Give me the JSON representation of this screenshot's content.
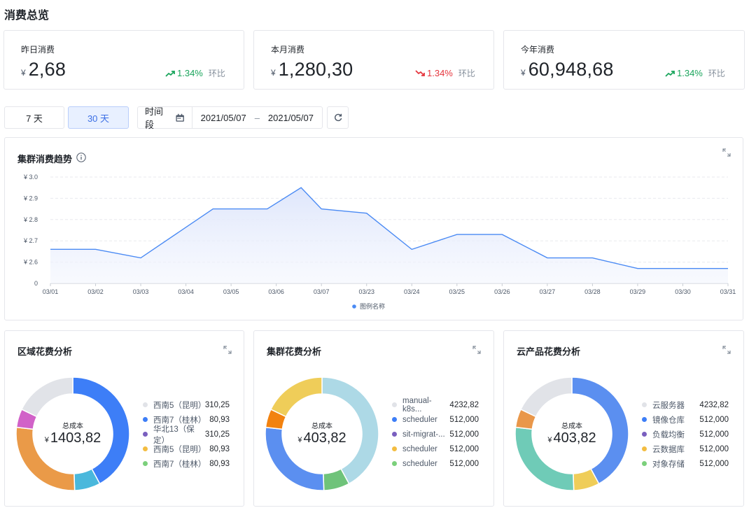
{
  "page": {
    "title": "消费总览"
  },
  "stats": [
    {
      "label": "昨日消费",
      "currency": "¥",
      "value": "2,68",
      "pct": "1.34%",
      "ref": "环比",
      "direction": "up",
      "color": "#1aa55c"
    },
    {
      "label": "本月消费",
      "currency": "¥",
      "value": "1,280,30",
      "pct": "1.34%",
      "ref": "环比",
      "direction": "down",
      "color": "#e5353d"
    },
    {
      "label": "今年消费",
      "currency": "¥",
      "value": "60,948,68",
      "pct": "1.34%",
      "ref": "环比",
      "direction": "up",
      "color": "#1aa55c"
    }
  ],
  "filters": {
    "btn7": "7 天",
    "btn30": "30 天",
    "range_label": "时间段",
    "start": "2021/05/07",
    "sep": "–",
    "end": "2021/05/07"
  },
  "trend": {
    "title": "集群消费趋势"
  },
  "donuts": [
    {
      "title": "区域花费分析",
      "center_label": "总成本",
      "currency": "¥",
      "center_value": "1403,82",
      "legend": [
        {
          "name": "西南5（昆明）",
          "value": "310,25",
          "color": "#e1e3e8"
        },
        {
          "name": "西南7（桂林）",
          "value": "80,93",
          "color": "#3d7ef7"
        },
        {
          "name": "华北13（保定）",
          "value": "310,25",
          "color": "#7a5fbf"
        },
        {
          "name": "西南5（昆明）",
          "value": "80,93",
          "color": "#f3bd41"
        },
        {
          "name": "西南7（桂林）",
          "value": "80,93",
          "color": "#7bd07b"
        }
      ]
    },
    {
      "title": "集群花费分析",
      "center_label": "总成本",
      "currency": "¥",
      "center_value": "403,82",
      "legend": [
        {
          "name": "manual-k8s...",
          "value": "4232,82",
          "color": "#e1e3e8"
        },
        {
          "name": "scheduler",
          "value": "512,000",
          "color": "#3d7ef7"
        },
        {
          "name": "sit-migrat-...",
          "value": "512,000",
          "color": "#7a5fbf"
        },
        {
          "name": "scheduler",
          "value": "512,000",
          "color": "#f3bd41"
        },
        {
          "name": "scheduler",
          "value": "512,000",
          "color": "#7bd07b"
        }
      ]
    },
    {
      "title": "云产品花费分析",
      "center_label": "总成本",
      "currency": "¥",
      "center_value": "403,82",
      "legend": [
        {
          "name": "云服务器",
          "value": "4232,82",
          "color": "#e1e3e8"
        },
        {
          "name": "镜像仓库",
          "value": "512,000",
          "color": "#3d7ef7"
        },
        {
          "name": "负载均衡",
          "value": "512,000",
          "color": "#7a5fbf"
        },
        {
          "name": "云数据库",
          "value": "512,000",
          "color": "#f3bd41"
        },
        {
          "name": "对象存储",
          "value": "512,000",
          "color": "#7bd07b"
        }
      ]
    }
  ],
  "chart_data": [
    {
      "type": "area",
      "title": "集群消费趋势",
      "categories": [
        "03/01",
        "03/02",
        "03/03",
        "03/04",
        "03/05",
        "03/06",
        "03/07",
        "03/23",
        "03/24",
        "03/25",
        "03/26",
        "03/27",
        "03/28",
        "03/29",
        "03/30",
        "03/31"
      ],
      "x_points": [
        0,
        1,
        2,
        3.6,
        4.8,
        5.55,
        6,
        7,
        8,
        9,
        10,
        11,
        12,
        13,
        14,
        15
      ],
      "values": [
        2.66,
        2.66,
        2.62,
        2.85,
        2.85,
        2.95,
        2.85,
        2.83,
        2.66,
        2.73,
        2.73,
        2.62,
        2.62,
        2.57,
        2.57,
        2.57
      ],
      "y_ticks": [
        "¥ 3.0",
        "¥ 2.9",
        "¥ 2.8",
        "¥ 2.7",
        "¥ 2.6",
        "0"
      ],
      "y_tick_values": [
        3.0,
        2.9,
        2.8,
        2.7,
        2.6,
        2.5
      ],
      "ylim": [
        2.5,
        3.0
      ],
      "legend": [
        {
          "name": "图例名称",
          "color": "#4a8af4"
        }
      ],
      "color": "#4a8af4",
      "grid": true
    },
    {
      "type": "pie",
      "title": "区域花费分析",
      "labels": [
        "",
        "",
        "",
        "",
        ""
      ],
      "values": [
        40,
        7,
        26,
        5,
        17
      ],
      "colors": [
        "#3d7ef7",
        "#4ab8dc",
        "#ea9a48",
        "#d162c8",
        "#e1e3e8"
      ]
    },
    {
      "type": "pie",
      "title": "集群花费分析",
      "labels": [
        "",
        "",
        "",
        "",
        ""
      ],
      "values": [
        40,
        7,
        26,
        5,
        17
      ],
      "colors": [
        "#add9e6",
        "#6fc37a",
        "#5b8ff0",
        "#f2820f",
        "#efcd59"
      ]
    },
    {
      "type": "pie",
      "title": "云产品花费分析",
      "labels": [
        "",
        "",
        "",
        "",
        ""
      ],
      "values": [
        40,
        7,
        26,
        5,
        17
      ],
      "colors": [
        "#5b8ff0",
        "#efcd59",
        "#6fcbb7",
        "#e9974a",
        "#e1e3e8"
      ]
    }
  ]
}
